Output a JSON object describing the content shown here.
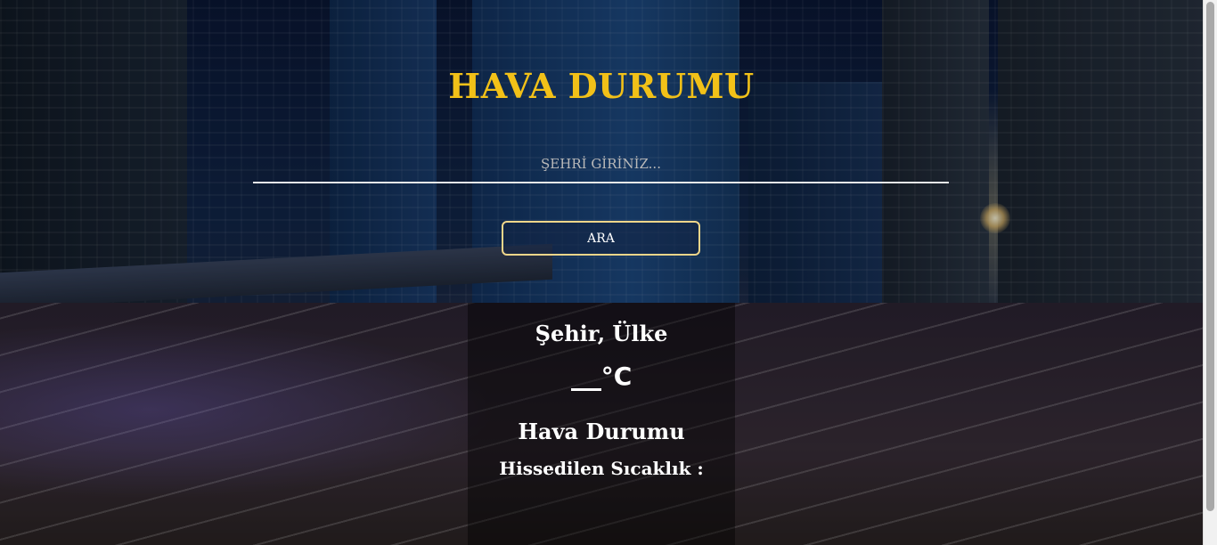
{
  "app": {
    "title": "HAVA DURUMU"
  },
  "search": {
    "placeholder": "ŞEHRİ GİRİNİZ...",
    "value": "",
    "button_label": "ARA"
  },
  "result": {
    "city": "Şehir, Ülke",
    "temperature": "",
    "unit": "°C",
    "description": "Hava Durumu",
    "feels_like_label": "Hissedilen Sıcaklık :"
  },
  "colors": {
    "title": "#f2c118",
    "button_border": "#f0d68a"
  }
}
